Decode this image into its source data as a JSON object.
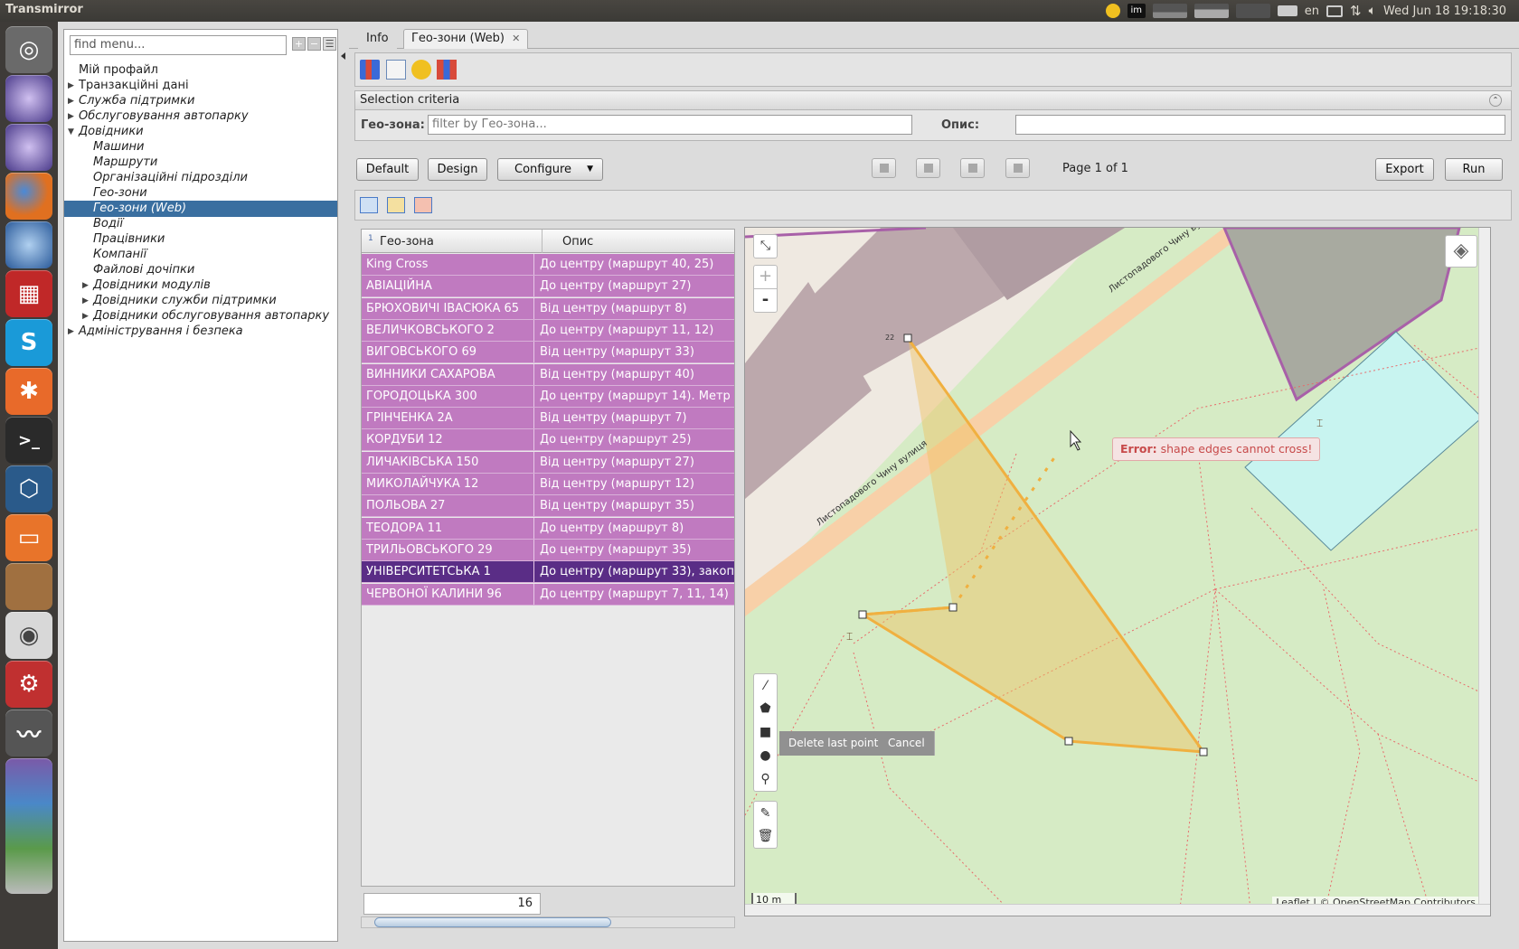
{
  "topbar": {
    "app_title": "Transmirror",
    "keyboard": "en",
    "datetime": "Wed Jun 18 19:18:30"
  },
  "launcher": {
    "icons": [
      "ubuntu-dash-icon",
      "eclipse-icon",
      "eclipse-icon",
      "firefox-icon",
      "thunderbird-icon",
      "app-red-icon",
      "skype-icon",
      "xmind-icon",
      "terminal-icon",
      "virtualbox-icon",
      "files-icon",
      "acorn-icon",
      "speaker-icon",
      "settings-icon",
      "system-monitor-icon",
      "stacked-apps-icon"
    ]
  },
  "leftpanel": {
    "find_placeholder": "find menu...",
    "tree": [
      {
        "label": "Мій профайл",
        "level": 0,
        "arrow": ""
      },
      {
        "label": "Транзакційні дані",
        "level": 0,
        "arrow": "▶"
      },
      {
        "label": "Служба підтримки",
        "level": 0,
        "arrow": "▶",
        "italic": true
      },
      {
        "label": "Обслуговування автопарку",
        "level": 0,
        "arrow": "▶",
        "italic": true
      },
      {
        "label": "Довідники",
        "level": 0,
        "arrow": "▼",
        "italic": true
      },
      {
        "label": "Машини",
        "level": 1,
        "arrow": "",
        "italic": true
      },
      {
        "label": "Маршрути",
        "level": 1,
        "arrow": "",
        "italic": true
      },
      {
        "label": "Організаційні підрозділи",
        "level": 1,
        "arrow": "",
        "italic": true
      },
      {
        "label": "Гео-зони",
        "level": 1,
        "arrow": "",
        "italic": true
      },
      {
        "label": "Гео-зони (Web)",
        "level": 1,
        "arrow": "",
        "italic": true,
        "selected": true
      },
      {
        "label": "Водії",
        "level": 1,
        "arrow": "",
        "italic": true
      },
      {
        "label": "Працівники",
        "level": 1,
        "arrow": "",
        "italic": true
      },
      {
        "label": "Компанії",
        "level": 1,
        "arrow": "",
        "italic": true
      },
      {
        "label": "Файлові дочіпки",
        "level": 1,
        "arrow": "",
        "italic": true
      },
      {
        "label": "Довідники модулів",
        "level": 1,
        "arrow": "▶",
        "italic": true
      },
      {
        "label": "Довідники служби підтримки",
        "level": 1,
        "arrow": "▶",
        "italic": true
      },
      {
        "label": "Довідники обслуговування автопарку",
        "level": 1,
        "arrow": "▶",
        "italic": true
      },
      {
        "label": "Адміністрування і безпека",
        "level": 0,
        "arrow": "▶",
        "italic": true
      }
    ]
  },
  "tabs": [
    {
      "label": "Info"
    },
    {
      "label": "Гео-зони (Web)",
      "close": "✕"
    }
  ],
  "criteria": {
    "header": "Selection criteria",
    "geo_label": "Гео-зона:",
    "geo_placeholder": "filter by Гео-зона...",
    "desc_label": "Опис:",
    "desc_value": ""
  },
  "actions": {
    "default": "Default",
    "design": "Design",
    "configure": "Configure",
    "page_info": "Page 1 of 1",
    "export": "Export",
    "run": "Run"
  },
  "grid": {
    "columns": [
      "Гео-зона",
      "Опис"
    ],
    "sort_index": "1",
    "rows": [
      [
        "King Cross",
        "До центру (маршрут 40, 25)"
      ],
      [
        "АВІАЦІЙНА",
        "До центру (маршрут 27)"
      ],
      [
        "БРЮХОВИЧІ ІВАСЮКА 65",
        "Від центру (маршрут 8)"
      ],
      [
        "ВЕЛИЧКОВСЬКОГО 2",
        "До центру (маршрут 11, 12)"
      ],
      [
        "ВИГОВСЬКОГО 69",
        "Від центру (маршрут 33)"
      ],
      [
        "ВИННИКИ САХАРОВА",
        "Від центру (маршрут 40)"
      ],
      [
        "ГОРОДОЦЬКА 300",
        "До центру (маршрут 14). Метр"
      ],
      [
        "ГРІНЧЕНКА 2А",
        "Від центру (маршрут 7)"
      ],
      [
        "КОРДУБИ 12",
        "До центру (маршрут 25)"
      ],
      [
        "ЛИЧАКІВСЬКА 150",
        "Від центру (маршрут 27)"
      ],
      [
        "МИКОЛАЙЧУКА 12",
        "Від центру (маршрут 12)"
      ],
      [
        "ПОЛЬОВА 27",
        "Від центру (маршрут 35)"
      ],
      [
        "ТЕОДОРА 11",
        "До центру (маршрут 8)"
      ],
      [
        "ТРИЛЬОВСЬКОГО 29",
        "До центру (маршрут 35)"
      ],
      [
        "УНІВЕРСИТЕТСЬКА 1",
        "До центру (маршрут 33), закоп"
      ],
      [
        "ЧЕРВОНОЇ КАЛИНИ 96",
        "До центру (маршрут 7, 11, 14)"
      ]
    ],
    "selected_row": 14,
    "count": "16"
  },
  "map": {
    "zoom_in": "+",
    "zoom_out": "-",
    "street_label_1": "Листопадового Чину вулиця",
    "street_label_2": "Листопадового Чину ву",
    "vertex_label": "22",
    "delete_last_point": "Delete last point",
    "cancel": "Cancel",
    "error_prefix": "Error:",
    "error_message": "shape edges cannot cross!",
    "scale": "10 m",
    "attribution": "Leaflet | © OpenStreetMap Contributors",
    "colors": {
      "polygon": "#f0c060",
      "polygon_stroke": "#f0b040",
      "zone_fill": "#c8f4f0",
      "road": "#f8d0a8",
      "grass": "#d6ebc5",
      "building": "#bca8ac",
      "selected_row": "#5a2d86",
      "row": "#c07ac0"
    }
  }
}
